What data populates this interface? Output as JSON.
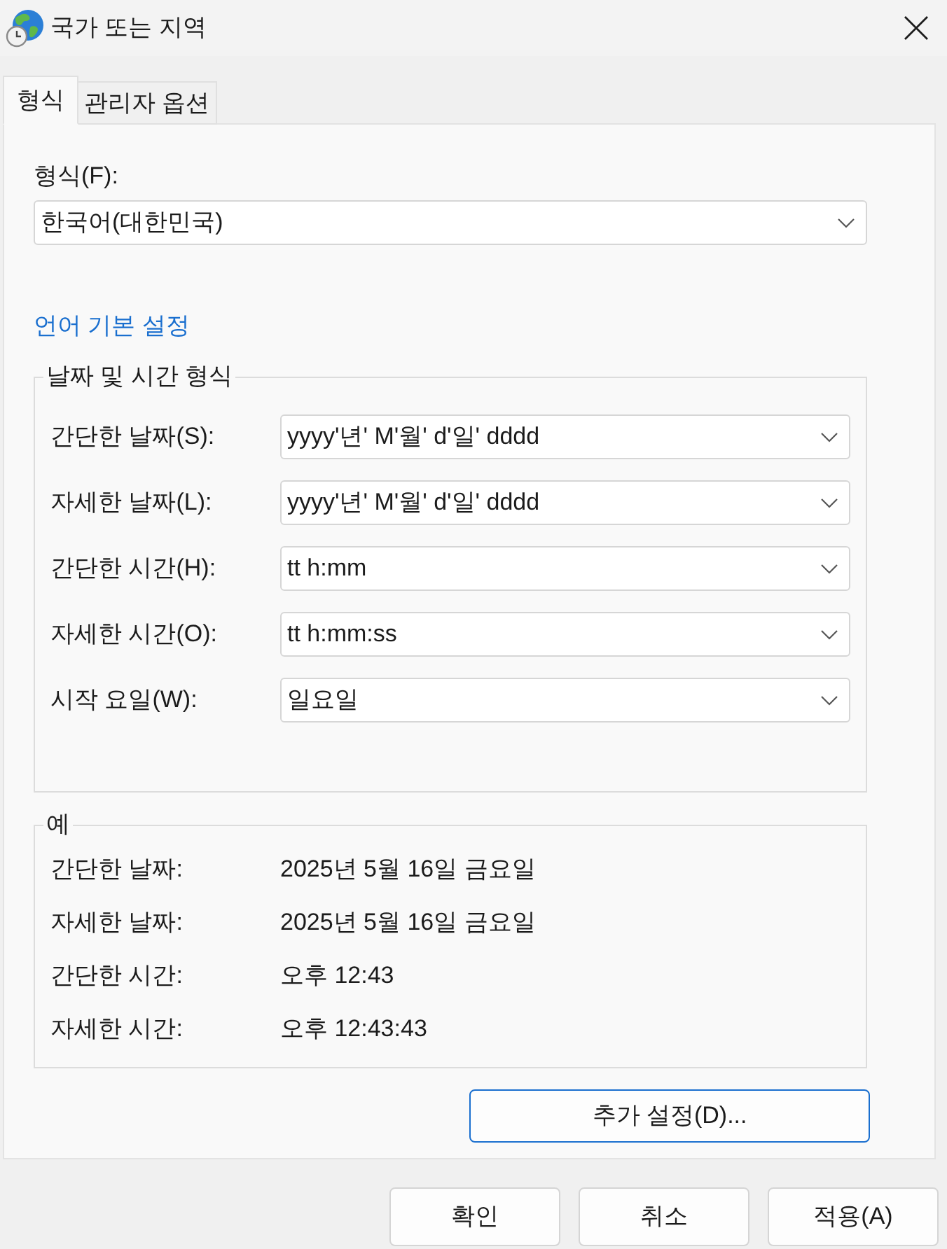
{
  "window": {
    "title": "국가 또는 지역"
  },
  "tabs": [
    {
      "label": "형식",
      "selected": true
    },
    {
      "label": "관리자 옵션",
      "selected": false
    }
  ],
  "format": {
    "label": "형식(F):",
    "value": "한국어(대한민국)"
  },
  "language_link": "언어 기본 설정",
  "date_time_formats": {
    "title": "날짜 및 시간 형식",
    "rows": [
      {
        "label": "간단한 날짜(S):",
        "value": "yyyy'년' M'월' d'일' dddd"
      },
      {
        "label": "자세한 날짜(L):",
        "value": "yyyy'년' M'월' d'일' dddd"
      },
      {
        "label": "간단한 시간(H):",
        "value": "tt h:mm"
      },
      {
        "label": "자세한 시간(O):",
        "value": "tt h:mm:ss"
      },
      {
        "label": "시작 요일(W):",
        "value": "일요일"
      }
    ]
  },
  "examples": {
    "title": "예",
    "rows": [
      {
        "label": "간단한 날짜:",
        "value": "2025년 5월 16일 금요일"
      },
      {
        "label": "자세한 날짜:",
        "value": "2025년 5월 16일 금요일"
      },
      {
        "label": "간단한 시간:",
        "value": "오후 12:43"
      },
      {
        "label": "자세한 시간:",
        "value": "오후 12:43:43"
      }
    ]
  },
  "additional_settings": {
    "label": "추가 설정(D)...",
    "default": true
  },
  "buttons": [
    "확인",
    "취소",
    "적용(A)"
  ]
}
